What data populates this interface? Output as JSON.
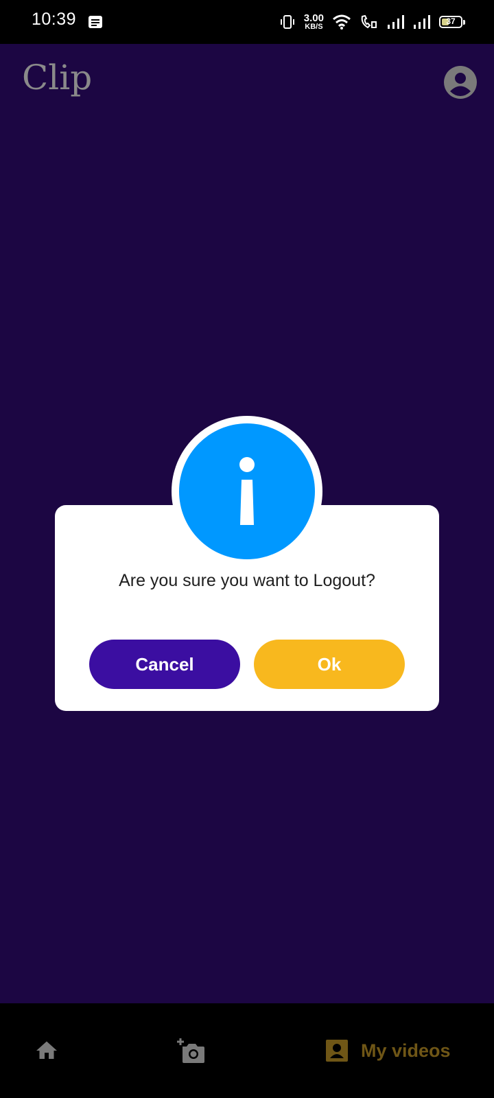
{
  "status_bar": {
    "time": "10:39",
    "net_speed_value": "3.00",
    "net_speed_unit": "KB/S",
    "battery_level": "37"
  },
  "app_bar": {
    "title": "Clip"
  },
  "dialog": {
    "message": "Are you sure you want to Logout?",
    "cancel_label": "Cancel",
    "ok_label": "Ok"
  },
  "bottom_nav": {
    "items": [
      {
        "icon": "home-icon",
        "label": ""
      },
      {
        "icon": "add-camera-icon",
        "label": ""
      },
      {
        "icon": "portrait-icon",
        "label": "My videos"
      }
    ]
  },
  "colors": {
    "background": "#1c0643",
    "info_blue": "#0098ff",
    "cancel_purple": "#3b0ea1",
    "ok_yellow": "#f8b81e",
    "nav_active": "#6f5616"
  }
}
